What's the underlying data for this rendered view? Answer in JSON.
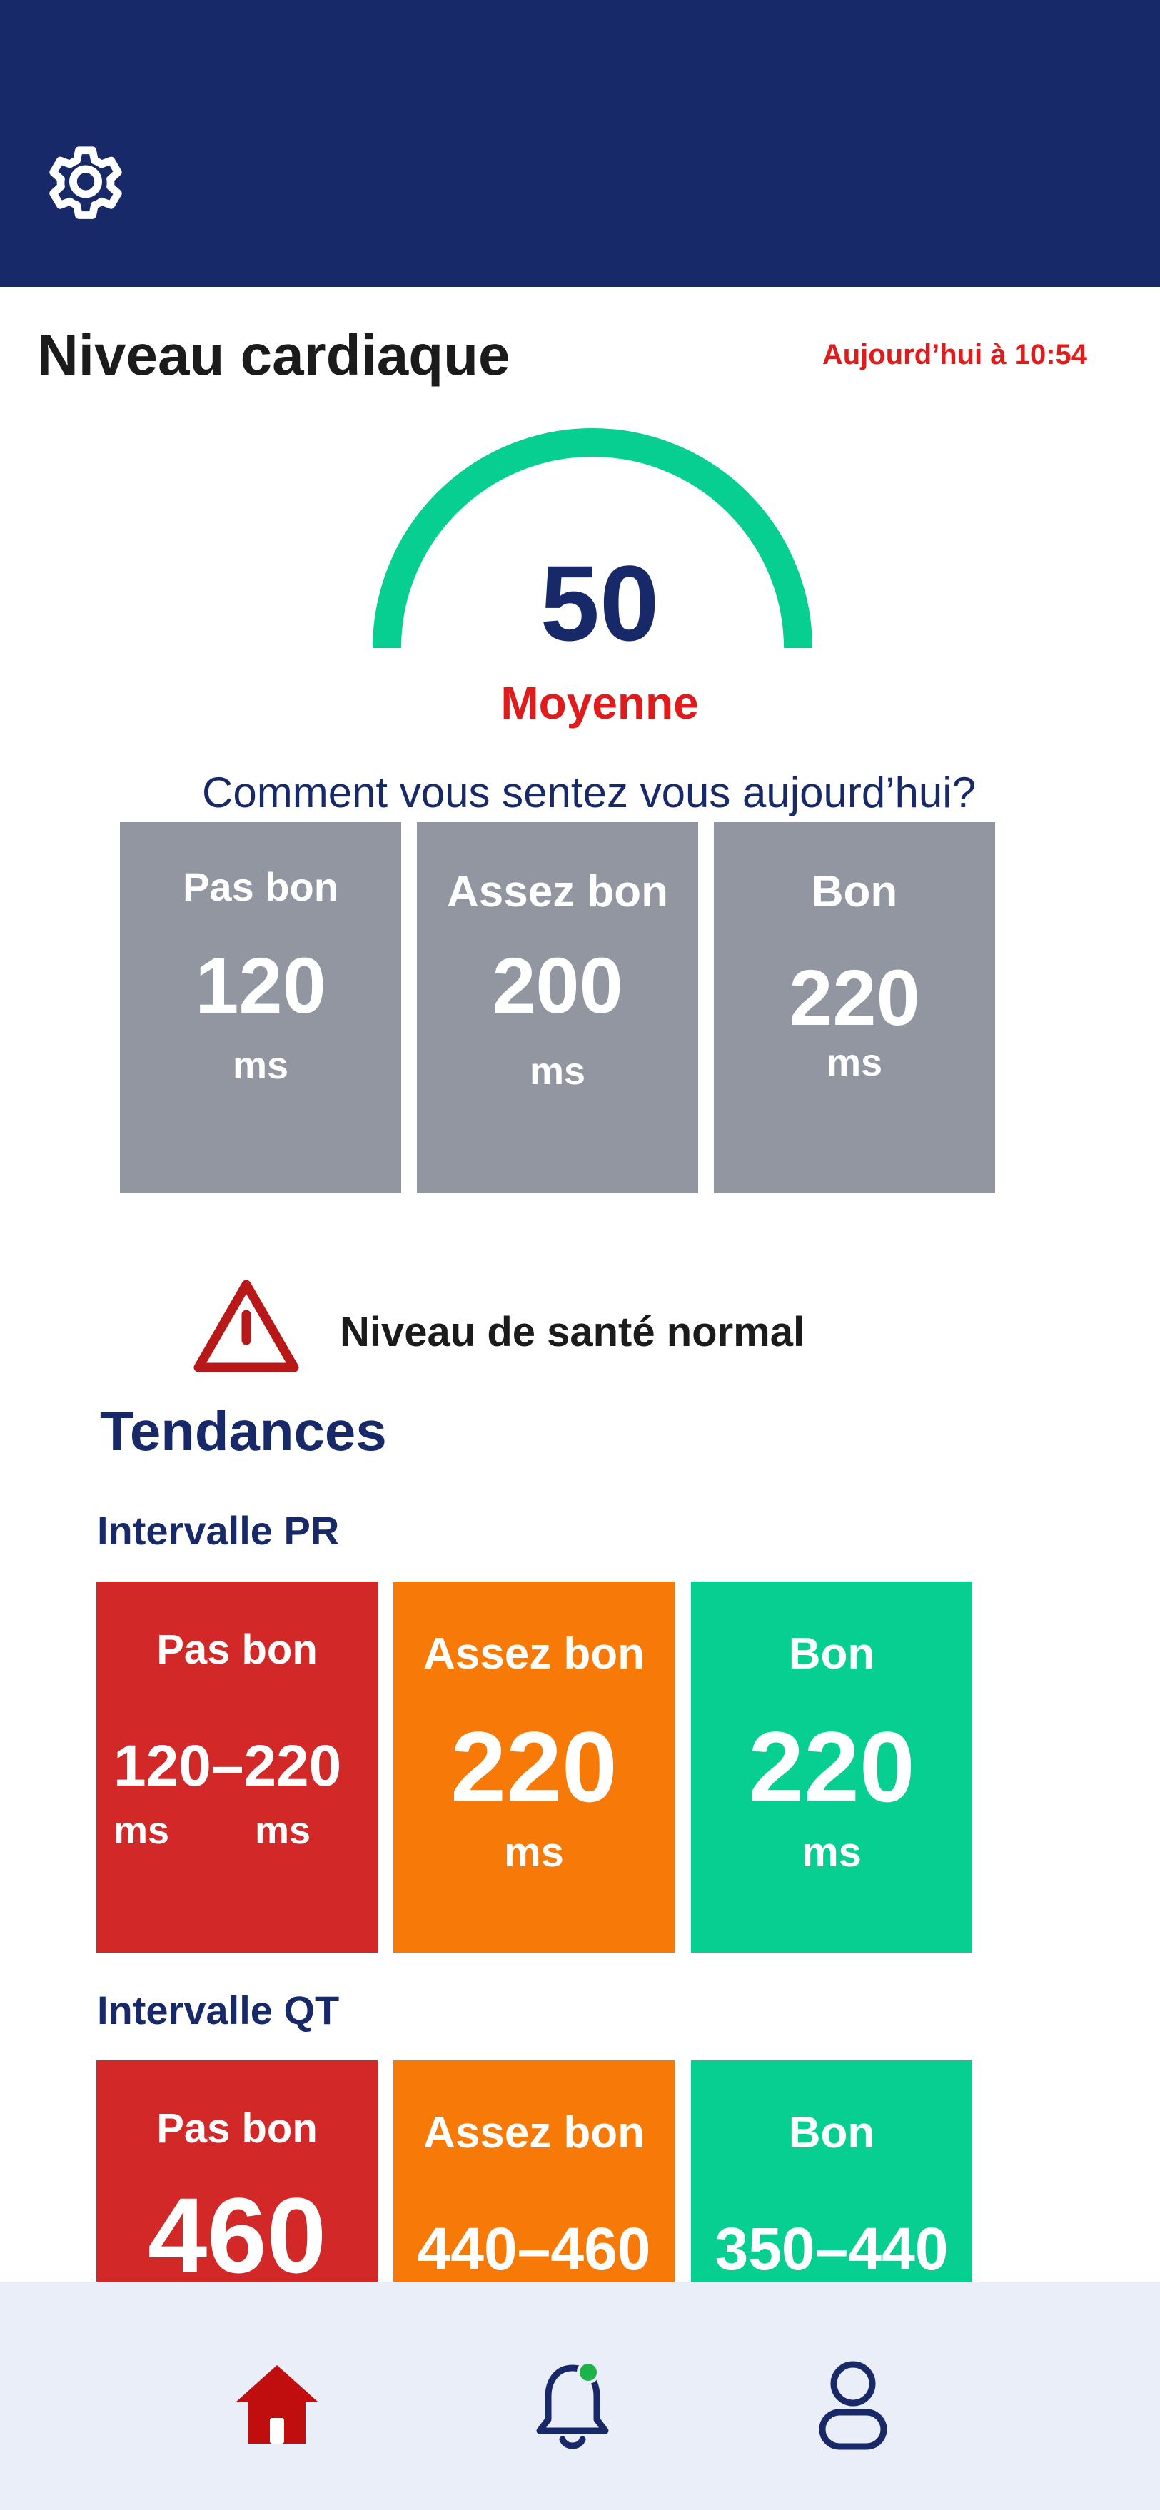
{
  "header": {
    "settings_icon": "gear-icon",
    "background_color": "#172969"
  },
  "heart": {
    "title": "Niveau cardiaque",
    "timestamp": "Aujourd’hui à 10:54",
    "gauge_value": "50",
    "gauge_label": "Moyenne",
    "gauge_color": "#06cf91"
  },
  "feeling": {
    "question": "Comment vous sentez vous aujourd’hui?",
    "options": [
      {
        "label": "Pas bon",
        "value": "120",
        "unit": "ms"
      },
      {
        "label": "Assez bon",
        "value": "200",
        "unit": "ms"
      },
      {
        "label": "Bon",
        "value": "220",
        "unit": "ms"
      }
    ]
  },
  "status": {
    "icon": "warning-icon",
    "text": "Niveau de santé normal"
  },
  "trends": {
    "title": "Tendances",
    "pr": {
      "title": "Intervalle PR",
      "tiles": [
        {
          "label": "Pas bon",
          "value_a": "120",
          "dash": "–",
          "value_b": "220",
          "unit_a": "ms",
          "unit_b": "ms"
        },
        {
          "label": "Assez bon",
          "value": "220",
          "unit": "ms"
        },
        {
          "label": "Bon",
          "value": "220",
          "unit": "ms"
        }
      ]
    },
    "qt": {
      "title": "Intervalle QT",
      "tiles": [
        {
          "label": "Pas bon",
          "value": "460"
        },
        {
          "label": "Assez bon",
          "value": "440–460"
        },
        {
          "label": "Bon",
          "value": "350–440"
        }
      ]
    }
  },
  "colors": {
    "bad": "#d22828",
    "medium": "#f77a08",
    "good": "#06cf91",
    "neutral": "#9196a1",
    "accent_red": "#e01b1b"
  },
  "nav": {
    "items": [
      {
        "icon": "home-icon",
        "active": true
      },
      {
        "icon": "bell-icon",
        "has_notification": true
      },
      {
        "icon": "profile-icon",
        "active": false
      }
    ]
  }
}
